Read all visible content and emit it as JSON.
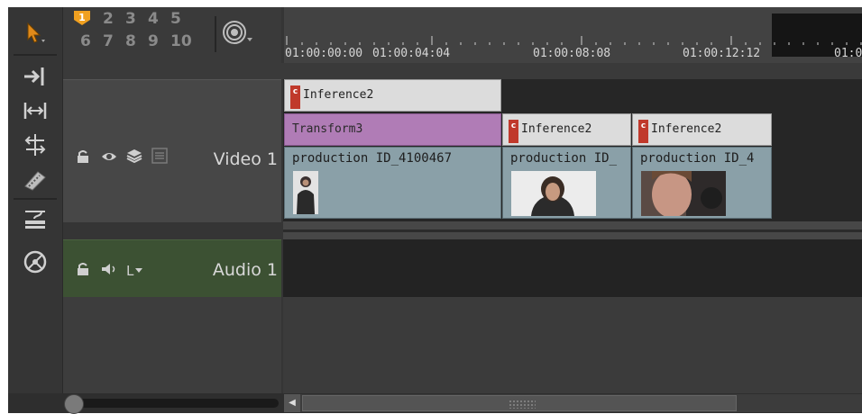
{
  "track_selector": {
    "numbers_row1": [
      "2",
      "3",
      "4",
      "5"
    ],
    "numbers_row2": [
      "6",
      "7",
      "8",
      "9",
      "10"
    ],
    "active": "1"
  },
  "ruler": {
    "timecodes": [
      "01:00:00:00",
      "01:00:04:04",
      "01:00:08:08",
      "01:00:12:12",
      "01:0"
    ]
  },
  "tracks": {
    "video": {
      "name": "Video 1"
    },
    "audio": {
      "name": "Audio 1",
      "channel": "L"
    }
  },
  "clips": {
    "effect_top": {
      "tag": "c",
      "label": "Inference2"
    },
    "transform": {
      "label": "Transform3"
    },
    "effect_2": {
      "tag": "c",
      "label": "Inference2"
    },
    "effect_3": {
      "tag": "c",
      "label": "Inference2"
    },
    "source_1": {
      "label": "production ID_4100467"
    },
    "source_2": {
      "label": "production ID_"
    },
    "source_3": {
      "label": "production ID_4"
    }
  },
  "colors": {
    "accent": "#f0a020",
    "effect_tag": "#c0392b",
    "transform_clip": "#b07cb6",
    "source_clip": "#8aa0a8",
    "audio_header": "#3c5133"
  }
}
